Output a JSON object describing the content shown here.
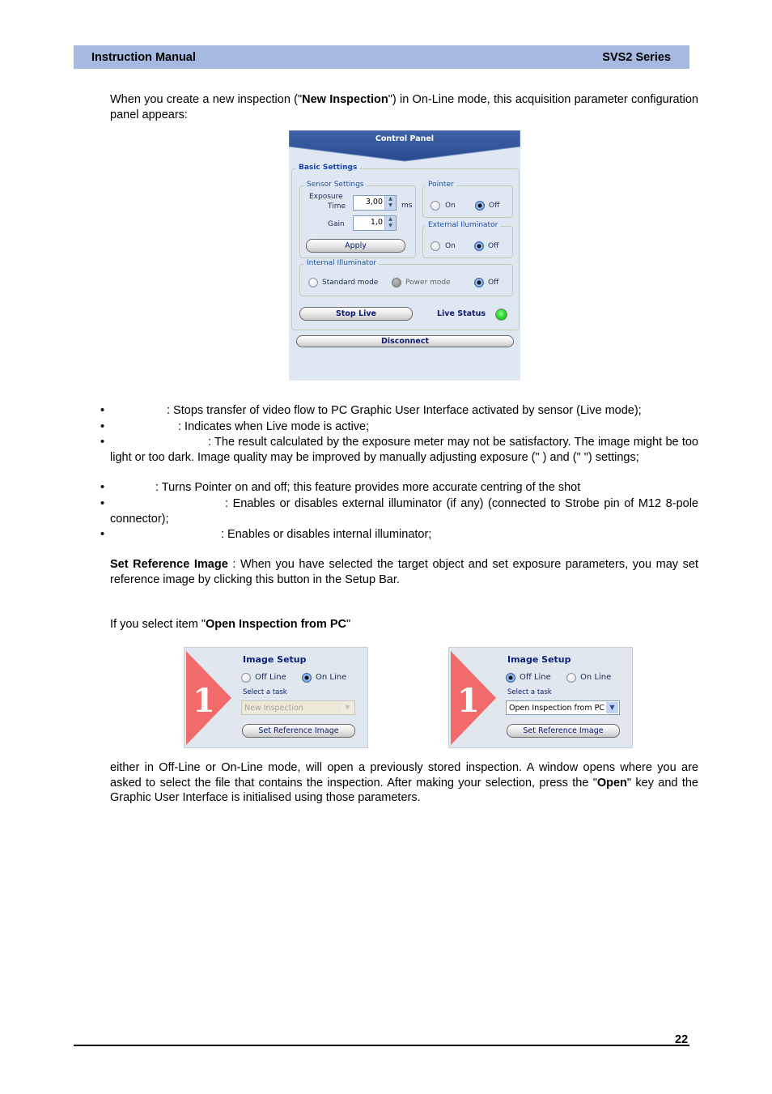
{
  "header": {
    "left": "Instruction Manual",
    "right": "SVS2 Series"
  },
  "intro": {
    "pre": "When you create a new inspection (\"",
    "bold": "New Inspection",
    "post": "\") in On-Line mode, this acquisition parameter configuration panel appears:"
  },
  "control_panel": {
    "title": "Control Panel",
    "basic_settings": "Basic Settings",
    "sensor_settings": "Sensor Settings",
    "exposure_label_1": "Exposure",
    "exposure_label_2": "Time",
    "exposure_value": "3,00",
    "exposure_unit": "ms",
    "gain_label": "Gain",
    "gain_value": "1,0",
    "apply": "Apply",
    "pointer": {
      "legend": "Pointer",
      "on": "On",
      "off": "Off",
      "selected": "Off"
    },
    "external": {
      "legend": "External Iluminator",
      "on": "On",
      "off": "Off",
      "selected": "Off"
    },
    "internal": {
      "legend": "Internal Illuminator",
      "standard": "Standard mode",
      "power": "Power mode",
      "off": "Off",
      "selected": "Off"
    },
    "stop_live": "Stop Live",
    "live_status": "Live Status",
    "live_status_color": "#21d021",
    "disconnect": "Disconnect"
  },
  "bullets": [
    ": Stops transfer of video flow to PC Graphic User Interface activated by sensor (Live mode);",
    ": Indicates when Live mode is active;",
    ": The result calculated by the exposure meter may not be satisfactory. The image might be too light or too dark. Image quality may be improved by manually adjusting exposure (\"                    ) and (\"       \") settings;",
    ": Turns Pointer on and off; this feature provides more accurate centring of the shot",
    ": Enables or disables external illuminator (if any) (connected to Strobe pin of M12 8-pole connector);",
    ": Enables or disables internal illuminator;"
  ],
  "set_ref": {
    "bold": "Set Reference Image",
    "text": " : When you have selected the target object and set exposure parameters, you may set reference image by clicking this button in the Setup Bar."
  },
  "open_pc": {
    "pre": "If you select item \"",
    "bold": "Open Inspection from PC",
    "post": "\""
  },
  "image_setup": [
    {
      "title": "Image Setup",
      "step": "1",
      "offline": "Off Line",
      "online": "On Line",
      "mode": "On Line",
      "select_label": "Select a task",
      "task": "New Inspection",
      "task_enabled": false,
      "button": "Set Reference Image"
    },
    {
      "title": "Image Setup",
      "step": "1",
      "offline": "Off Line",
      "online": "On Line",
      "mode": "Off Line",
      "select_label": "Select a task",
      "task": "Open Inspection from PC",
      "task_enabled": true,
      "button": "Set Reference Image"
    }
  ],
  "closing": {
    "text1": "either in Off-Line or On-Line mode, will open a previously stored inspection. A window opens where you are asked to select the file that contains the inspection. After making your selection, press the \"",
    "bold": "Open",
    "text2": "\" key and the Graphic User Interface is initialised using those parameters."
  },
  "page_number": "22"
}
